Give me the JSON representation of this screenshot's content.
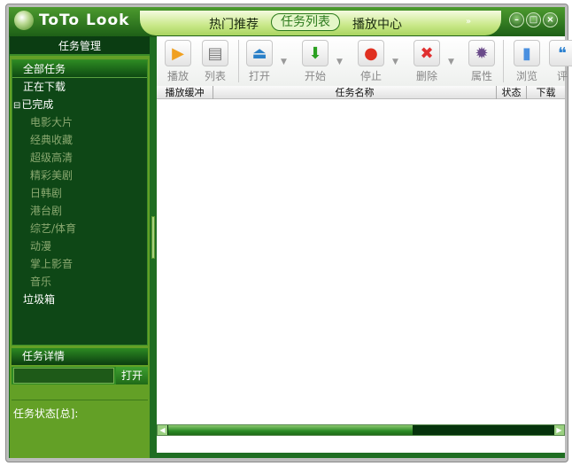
{
  "app": {
    "title": "ToTo Look"
  },
  "nav": {
    "items": [
      "热门推荐",
      "任务列表",
      "播放中心"
    ],
    "active": "任务列表",
    "more": "»"
  },
  "window_buttons": {
    "minimize": "–",
    "maximize": "□",
    "close": "×"
  },
  "sidebar": {
    "header": "任务管理",
    "items": [
      {
        "label": "全部任务"
      },
      {
        "label": "正在下载"
      },
      {
        "label": "已完成",
        "toggle": "⊟"
      }
    ],
    "completed_children": [
      "电影大片",
      "经典收藏",
      "超级高清",
      "精彩美剧",
      "日韩剧",
      "港台剧",
      "综艺/体育",
      "动漫",
      "掌上影音",
      "音乐"
    ],
    "trash": "垃圾箱",
    "detail_header": "任务详情",
    "detail_input": "",
    "open_label": "打开",
    "status_label": "任务状态[总]:"
  },
  "toolbar": {
    "buttons": [
      {
        "label": "播放",
        "icon": "play-icon"
      },
      {
        "label": "列表",
        "icon": "list-icon"
      },
      {
        "label": "打开",
        "icon": "eject-icon"
      },
      {
        "label": "开始",
        "icon": "download-arrow-icon"
      },
      {
        "label": "停止",
        "icon": "stop-icon"
      },
      {
        "label": "删除",
        "icon": "delete-icon"
      },
      {
        "label": "属性",
        "icon": "gear-icon"
      },
      {
        "label": "浏览",
        "icon": "browse-icon"
      },
      {
        "label": "评",
        "icon": "comment-icon"
      }
    ]
  },
  "columns": [
    "播放缓冲",
    "任务名称",
    "状态",
    "下载"
  ],
  "colors": {
    "frame": "#1f6e22",
    "sidebar_list": "#0e4716",
    "sidebar_panel": "#63a026",
    "nav": "#c8e888"
  }
}
